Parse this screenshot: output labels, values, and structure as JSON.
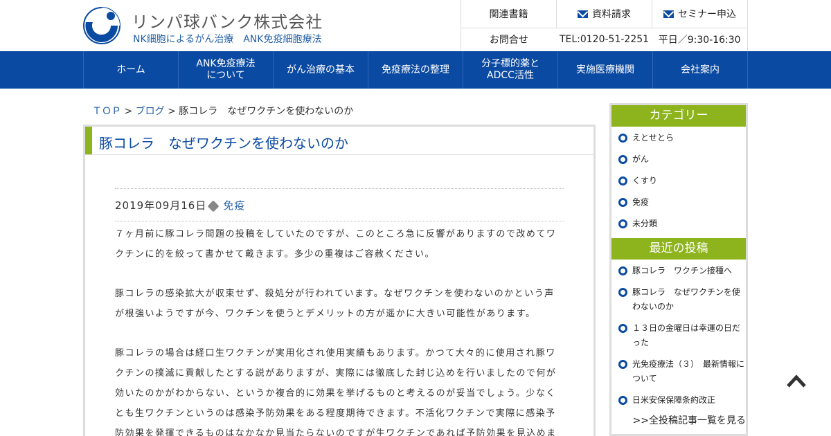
{
  "header": {
    "company_name": "リンパ球バンク株式会社",
    "tagline": "NK細胞によるがん治療　ANK免疫細胞療法",
    "links": [
      "関連書籍",
      "資料請求",
      "セミナー申込"
    ],
    "contact_label": "お問合せ",
    "phone": "TEL:0120-51-2251",
    "hours": "平日／9:30-16:30"
  },
  "nav": {
    "items": [
      "ホーム",
      "ANK免疫療法\nについて",
      "がん治療の基本",
      "免疫療法の整理",
      "分子標的薬と\nADCC活性",
      "実施医療機関",
      "会社案内"
    ]
  },
  "breadcrumb": {
    "top": "ＴＯＰ",
    "sep1": " > ",
    "blog": "ブログ",
    "sep2": " > ",
    "current": "豚コレラ　なぜワクチンを使わないのか"
  },
  "article": {
    "title": "豚コレラ　なぜワクチンを使わないのか",
    "date": "2019年09月16日",
    "category": "免疫",
    "paragraphs": [
      "７ヶ月前に豚コレラ問題の投稿をしていたのですが、このところ急に反響がありますので改めてワクチンに的を絞って書かせて戴きます。多少の重複はご容赦ください。",
      "豚コレラの感染拡大が収束せず、殺処分が行われています。なぜワクチンを使わないのかという声が根強いようですが今、ワクチンを使うとデメリットの方が遥かに大きい可能性があります。",
      "豚コレラの場合は経口生ワクチンが実用化され使用実績もあります。かつて大々的に使用され豚ワクチンの撲滅に貢献したとする説がありますが、実際には徹底した封じ込めを行いましたので何が効いたのかがわからない、というか複合的に効果を挙げるものと考えるのが妥当でしょう。少なくとも生ワクチンというのは感染予防効果をある程度期待できます。不活化ワクチンで実際に感染予防効果を発揮できるものはなかなか見当たらないのですが生ワクチンであれば予防効果を見込めま"
    ]
  },
  "sidebar": {
    "category_heading": "カテゴリー",
    "categories": [
      "えとせとら",
      "がん",
      "くすり",
      "免疫",
      "未分類"
    ],
    "recent_heading": "最近の投稿",
    "recent_posts": [
      "豚コレラ　ワクチン接種へ",
      "豚コレラ　なぜワクチンを使わないのか",
      "１３日の金曜日は幸運の日だった",
      "光免疫療法（３）　最新情報について",
      "日米安保保障条約改正"
    ],
    "more_link": ">>全投稿記事一覧を見る"
  },
  "colors": {
    "brand_blue": "#0b4aa2",
    "accent_green": "#8db31d",
    "link_blue": "#2460a7"
  }
}
